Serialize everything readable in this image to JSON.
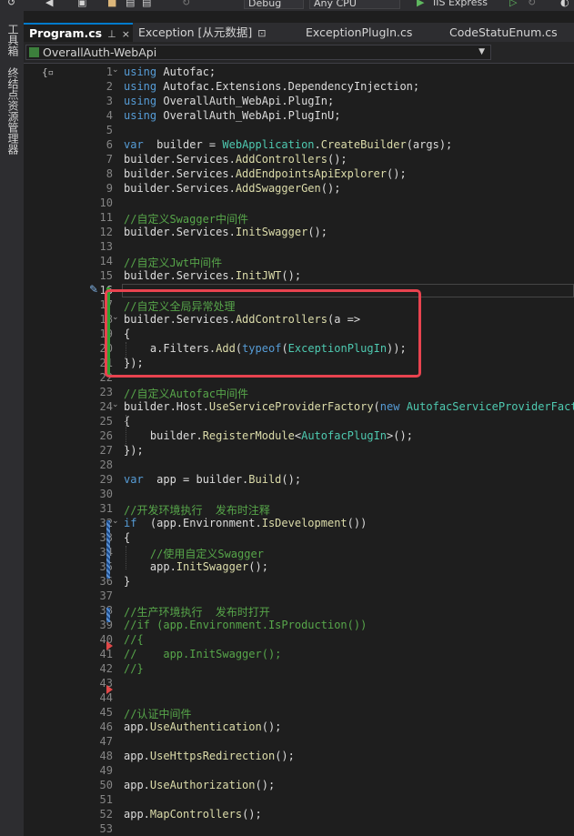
{
  "toolbar": {
    "config": "Debug",
    "platform": "Any CPU",
    "run_target": "IIS Express"
  },
  "left_strip": {
    "toolbox": "工具箱",
    "server_explorer": "终结点资源管理器"
  },
  "tabs": [
    {
      "label": "Program.cs",
      "pin": "⊥",
      "close": "×",
      "active": true
    },
    {
      "label": "Exception [从元数据]",
      "lock": "🔒",
      "active": false
    },
    {
      "label": "ExceptionPlugIn.cs",
      "active": false
    },
    {
      "label": "CodeStatuEnum.cs",
      "active": false
    }
  ],
  "navbar": {
    "project": "OverallAuth-WebApi"
  },
  "editor": {
    "current_line": 16,
    "lines": [
      {
        "n": "1",
        "tokens": [
          [
            "kw",
            "using"
          ],
          [
            "",
            "Autofac;"
          ]
        ]
      },
      {
        "n": "2",
        "tokens": [
          [
            "kw",
            "using"
          ],
          [
            "",
            "Autofac.Extensions.DependencyInjection;"
          ]
        ]
      },
      {
        "n": "3",
        "tokens": [
          [
            "kw",
            "using"
          ],
          [
            "",
            "OverallAuth_WebApi.PlugIn;"
          ]
        ]
      },
      {
        "n": "4",
        "tokens": [
          [
            "kw",
            "using"
          ],
          [
            "",
            "OverallAuth_WebApi.PlugInU;"
          ]
        ]
      },
      {
        "n": "5",
        "tokens": []
      },
      {
        "n": "6",
        "tokens": [
          [
            "kw",
            "var"
          ],
          [
            "",
            " builder = "
          ],
          [
            "ty",
            "WebApplication"
          ],
          [
            "",
            "."
          ],
          [
            "mt",
            "CreateBuilder"
          ],
          [
            "",
            "(args);"
          ]
        ]
      },
      {
        "n": "7",
        "tokens": [
          [
            "",
            "builder.Services."
          ],
          [
            "mt",
            "AddControllers"
          ],
          [
            "",
            "();"
          ]
        ]
      },
      {
        "n": "8",
        "tokens": [
          [
            "",
            "builder.Services."
          ],
          [
            "mt",
            "AddEndpointsApiExplorer"
          ],
          [
            "",
            "();"
          ]
        ]
      },
      {
        "n": "9",
        "tokens": [
          [
            "",
            "builder.Services."
          ],
          [
            "mt",
            "AddSwaggerGen"
          ],
          [
            "",
            "();"
          ]
        ]
      },
      {
        "n": "10",
        "tokens": []
      },
      {
        "n": "11",
        "tokens": [
          [
            "cm",
            "//自定义Swagger中间件"
          ]
        ]
      },
      {
        "n": "12",
        "tokens": [
          [
            "",
            "builder.Services."
          ],
          [
            "mt",
            "InitSwagger"
          ],
          [
            "",
            "();"
          ]
        ]
      },
      {
        "n": "13",
        "tokens": []
      },
      {
        "n": "14",
        "tokens": [
          [
            "cm",
            "//自定义Jwt中间件"
          ]
        ]
      },
      {
        "n": "15",
        "tokens": [
          [
            "",
            "builder.Services."
          ],
          [
            "mt",
            "InitJWT"
          ],
          [
            "",
            "();"
          ]
        ]
      },
      {
        "n": "16",
        "tokens": []
      },
      {
        "n": "17",
        "tokens": [
          [
            "cm",
            "//自定义全局异常处理"
          ]
        ]
      },
      {
        "n": "18",
        "tokens": [
          [
            "",
            "builder.Services."
          ],
          [
            "mt",
            "AddControllers"
          ],
          [
            "",
            "(a =>"
          ]
        ]
      },
      {
        "n": "19",
        "tokens": [
          [
            "",
            "{"
          ]
        ]
      },
      {
        "n": "20",
        "tokens": [
          [
            "",
            "    a.Filters."
          ],
          [
            "mt",
            "Add"
          ],
          [
            "",
            "("
          ],
          [
            "kw",
            "typeof"
          ],
          [
            "",
            "("
          ],
          [
            "ty",
            "ExceptionPlugIn"
          ],
          [
            "",
            "));"
          ]
        ]
      },
      {
        "n": "21",
        "tokens": [
          [
            "",
            "});"
          ]
        ]
      },
      {
        "n": "22",
        "tokens": []
      },
      {
        "n": "23",
        "tokens": [
          [
            "cm",
            "//自定义Autofac中间件"
          ]
        ]
      },
      {
        "n": "24",
        "tokens": [
          [
            "",
            "builder.Host."
          ],
          [
            "mt",
            "UseServiceProviderFactory"
          ],
          [
            "",
            "("
          ],
          [
            "kw",
            "new"
          ],
          [
            "",
            " "
          ],
          [
            "ty",
            "AutofacServiceProviderFactor"
          ]
        ]
      },
      {
        "n": "25",
        "tokens": [
          [
            "",
            "{"
          ]
        ]
      },
      {
        "n": "26",
        "tokens": [
          [
            "",
            "    builder."
          ],
          [
            "mt",
            "RegisterModule"
          ],
          [
            "",
            "<"
          ],
          [
            "ty",
            "AutofacPlugIn"
          ],
          [
            "",
            ">();"
          ]
        ]
      },
      {
        "n": "27",
        "tokens": [
          [
            "",
            "});"
          ]
        ]
      },
      {
        "n": "28",
        "tokens": []
      },
      {
        "n": "29",
        "tokens": [
          [
            "kw",
            "var"
          ],
          [
            "",
            " app = builder."
          ],
          [
            "mt",
            "Build"
          ],
          [
            "",
            "();"
          ]
        ]
      },
      {
        "n": "30",
        "tokens": []
      },
      {
        "n": "31",
        "tokens": [
          [
            "cm",
            "//开发环境执行  发布时注释"
          ]
        ]
      },
      {
        "n": "32",
        "tokens": [
          [
            "kw",
            "if"
          ],
          [
            "",
            " (app.Environment."
          ],
          [
            "mt",
            "IsDevelopment"
          ],
          [
            "",
            "())"
          ]
        ]
      },
      {
        "n": "33",
        "tokens": [
          [
            "",
            "{"
          ]
        ]
      },
      {
        "n": "34",
        "tokens": [
          [
            "cm",
            "    //使用自定义Swagger"
          ]
        ]
      },
      {
        "n": "35",
        "tokens": [
          [
            "",
            "    app."
          ],
          [
            "mt",
            "InitSwagger"
          ],
          [
            "",
            "();"
          ]
        ]
      },
      {
        "n": "36",
        "tokens": [
          [
            "",
            "}"
          ]
        ]
      },
      {
        "n": "37",
        "tokens": []
      },
      {
        "n": "38",
        "tokens": [
          [
            "cm",
            "//生产环境执行  发布时打开"
          ]
        ]
      },
      {
        "n": "39",
        "tokens": [
          [
            "cm",
            "//if (app.Environment.IsProduction())"
          ]
        ]
      },
      {
        "n": "40",
        "tokens": [
          [
            "cm",
            "//{"
          ]
        ]
      },
      {
        "n": "41",
        "tokens": [
          [
            "cm",
            "//    app.InitSwagger();"
          ]
        ]
      },
      {
        "n": "42",
        "tokens": [
          [
            "cm",
            "//}"
          ]
        ]
      },
      {
        "n": "43",
        "tokens": []
      },
      {
        "n": "44",
        "tokens": []
      },
      {
        "n": "45",
        "tokens": [
          [
            "cm",
            "//认证中间件"
          ]
        ]
      },
      {
        "n": "46",
        "tokens": [
          [
            "",
            "app."
          ],
          [
            "mt",
            "UseAuthentication"
          ],
          [
            "",
            "();"
          ]
        ]
      },
      {
        "n": "47",
        "tokens": []
      },
      {
        "n": "48",
        "tokens": [
          [
            "",
            "app."
          ],
          [
            "mt",
            "UseHttpsRedirection"
          ],
          [
            "",
            "();"
          ]
        ]
      },
      {
        "n": "49",
        "tokens": []
      },
      {
        "n": "50",
        "tokens": [
          [
            "",
            "app."
          ],
          [
            "mt",
            "UseAuthorization"
          ],
          [
            "",
            "();"
          ]
        ]
      },
      {
        "n": "51",
        "tokens": []
      },
      {
        "n": "52",
        "tokens": [
          [
            "",
            "app."
          ],
          [
            "mt",
            "MapControllers"
          ],
          [
            "",
            "();"
          ]
        ]
      },
      {
        "n": "53",
        "tokens": []
      }
    ]
  }
}
